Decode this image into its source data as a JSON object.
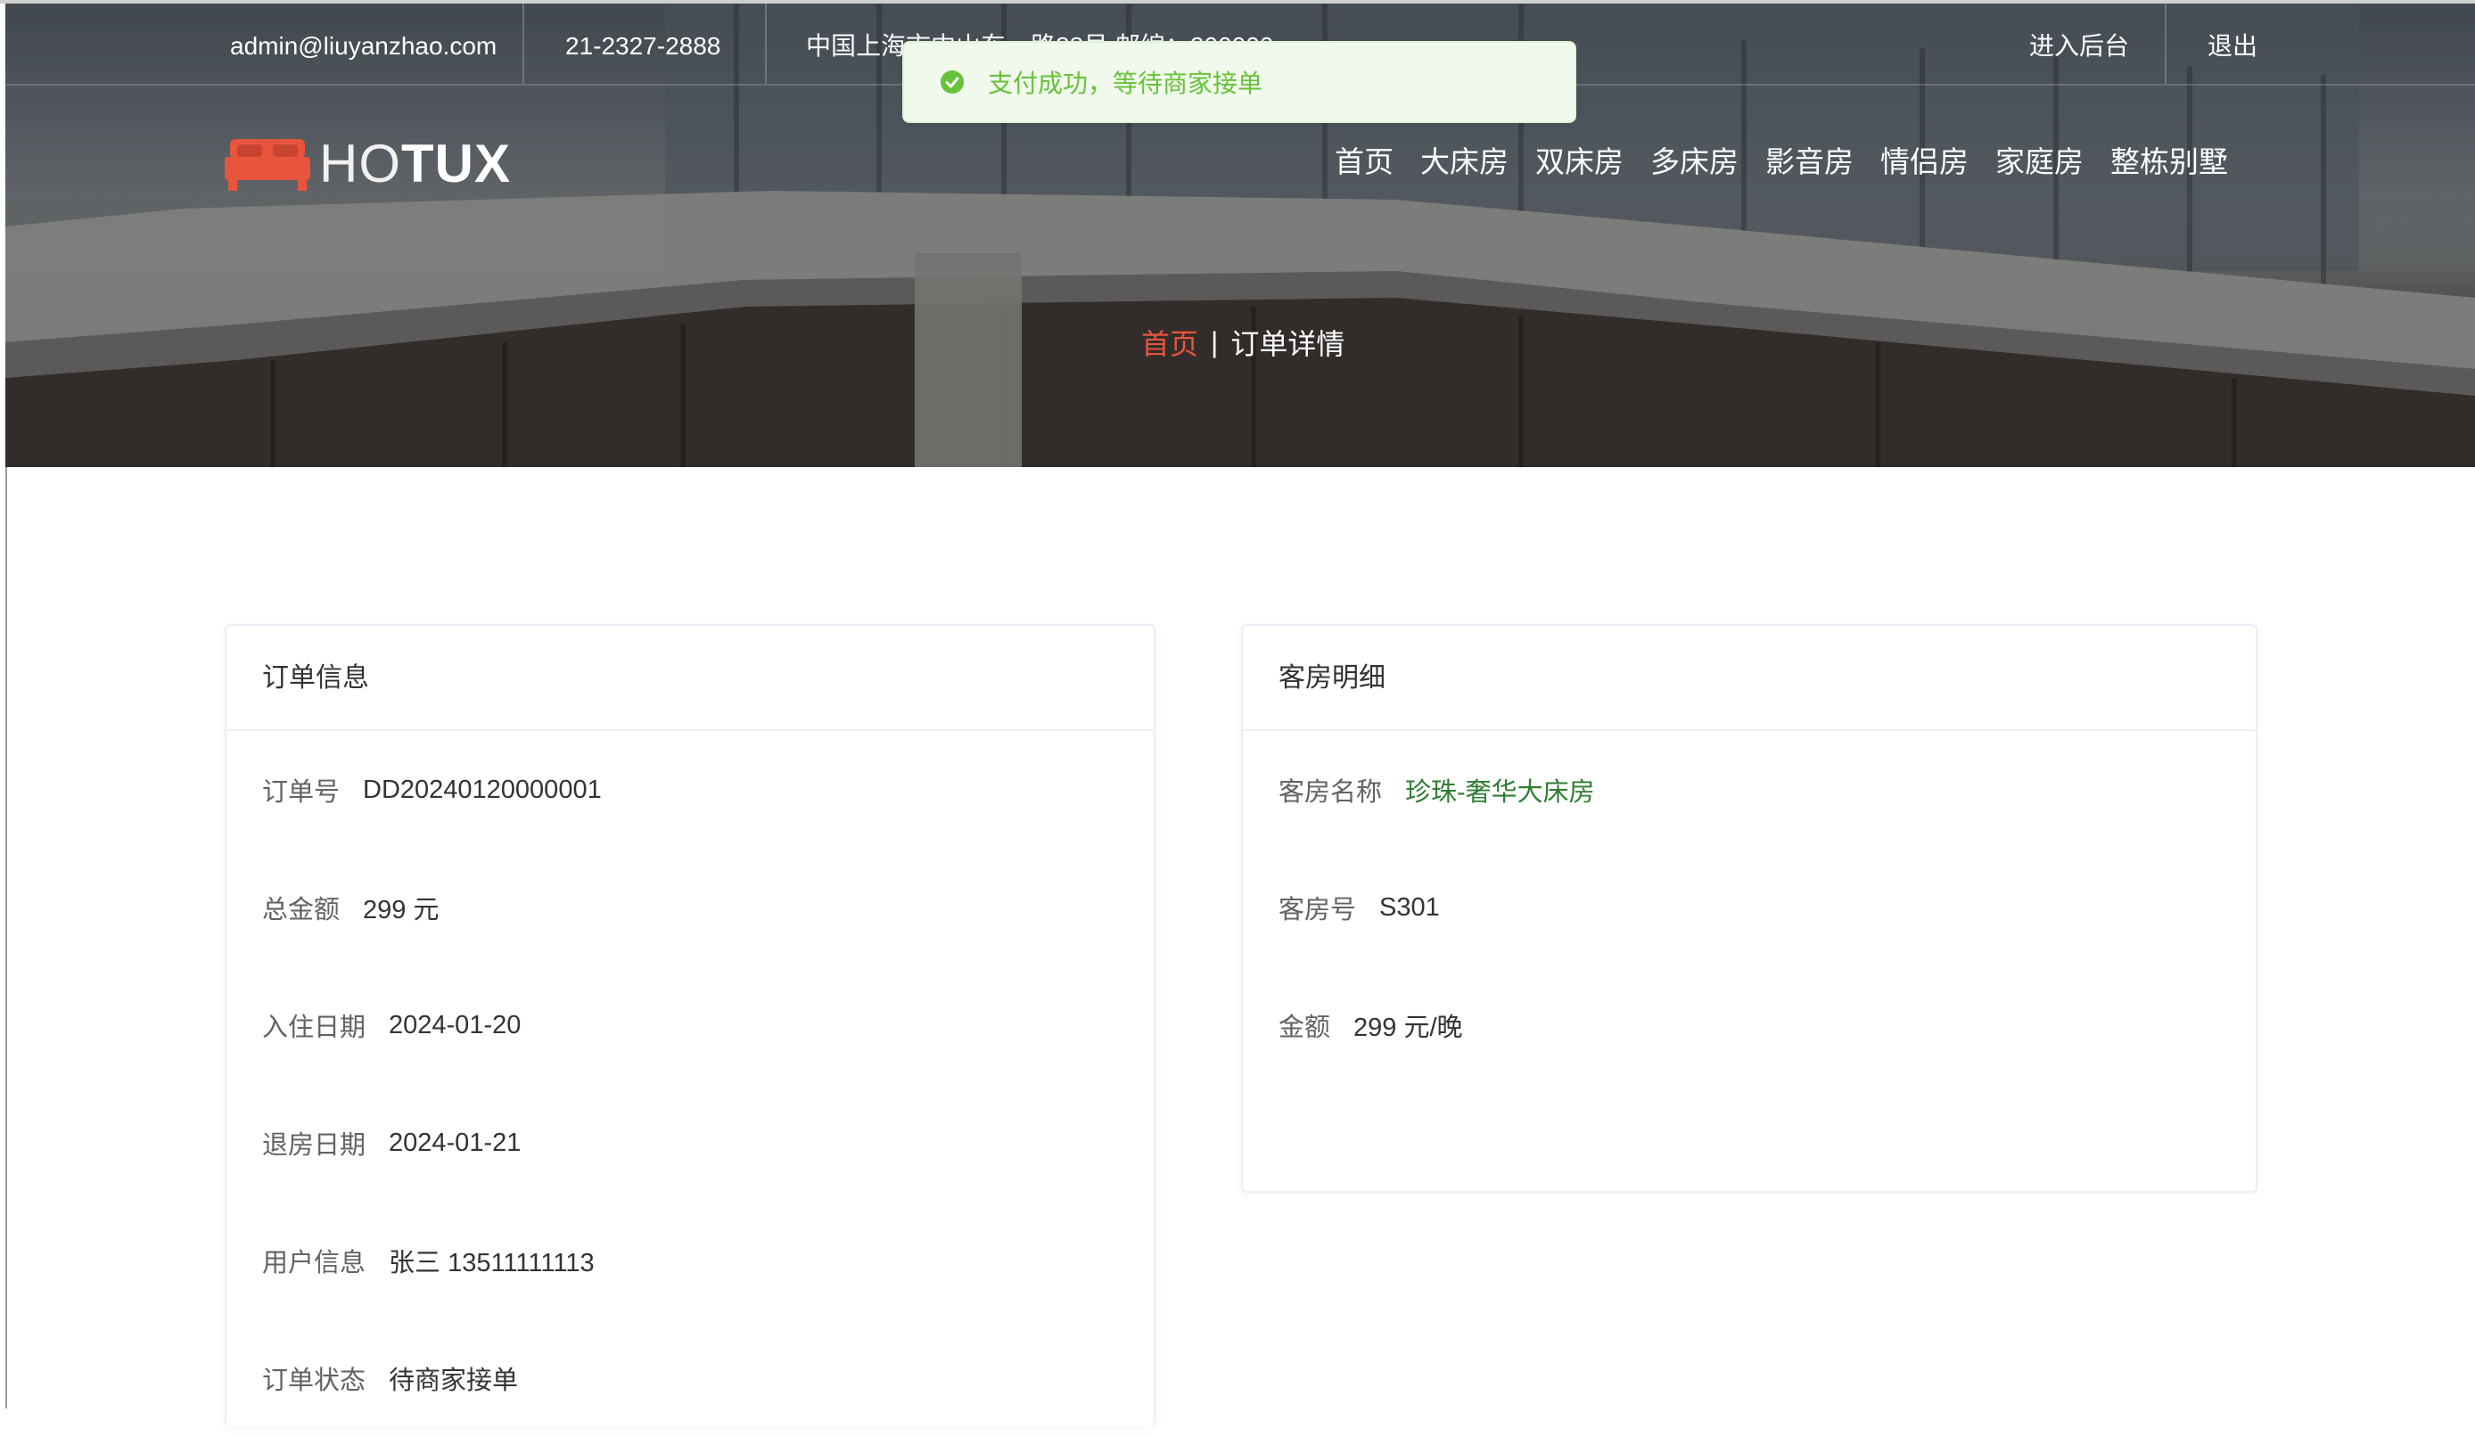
{
  "topbar": {
    "email": "admin@liuyanzhao.com",
    "phone": "21-2327-2888",
    "address": "中国上海市中山东一路88号 邮编：200000",
    "admin_link": "进入后台",
    "logout_link": "退出"
  },
  "logo": {
    "text_light": "HO",
    "text_bold": "TUX",
    "icon": "bed-icon"
  },
  "nav": {
    "items": [
      {
        "label": "首页"
      },
      {
        "label": "大床房"
      },
      {
        "label": "双床房"
      },
      {
        "label": "多床房"
      },
      {
        "label": "影音房"
      },
      {
        "label": "情侣房"
      },
      {
        "label": "家庭房"
      },
      {
        "label": "整栋别墅"
      }
    ]
  },
  "breadcrumb": {
    "home": "首页",
    "separator": "|",
    "current": "订单详情"
  },
  "toast": {
    "message": "支付成功，等待商家接单",
    "icon": "check-circle-icon"
  },
  "order": {
    "title": "订单信息",
    "fields": [
      {
        "label": "订单号",
        "value": "DD20240120000001"
      },
      {
        "label": "总金额",
        "value": "299 元"
      },
      {
        "label": "入住日期",
        "value": "2024-01-20"
      },
      {
        "label": "退房日期",
        "value": "2024-01-21"
      },
      {
        "label": "用户信息",
        "value": "张三 13511111113"
      },
      {
        "label": "订单状态",
        "value": "待商家接单"
      }
    ]
  },
  "room": {
    "title": "客房明细",
    "fields": [
      {
        "label": "客房名称",
        "value": "珍珠-奢华大床房"
      },
      {
        "label": "客房号",
        "value": "S301"
      },
      {
        "label": "金额",
        "value": "299 元/晚"
      }
    ]
  },
  "colors": {
    "accent": "#e8553d",
    "success": "#67c23a",
    "success_bg": "#f0f9eb",
    "link_green": "#2e7d32"
  }
}
